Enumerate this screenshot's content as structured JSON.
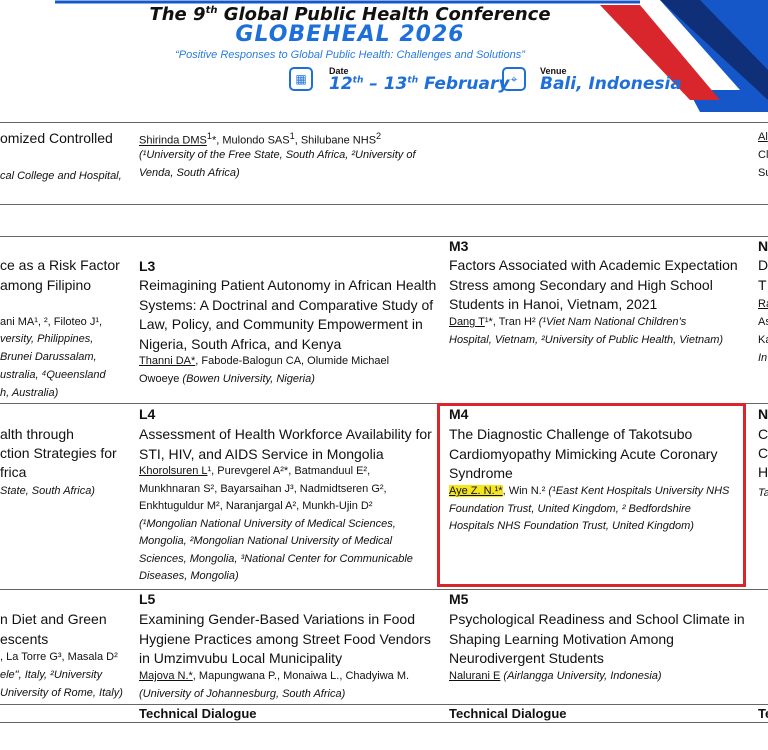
{
  "header": {
    "title_prefix": "The 9",
    "title_sup": "th",
    "title_suffix": " Global Public Health Conference",
    "name": "GLOBEHEAL 2026",
    "tagline": "“Positive Responses to Global Public Health: Challenges and Solutions”",
    "date_label": "Date",
    "date_a": "12",
    "date_a_sup": "th",
    "date_b": " – 13",
    "date_b_sup": "th",
    "date_c": " February",
    "venue_label": "Venue",
    "venue_value": "Bali, Indonesia",
    "accent": "#1e6fd9"
  },
  "row1": {
    "left_title_1": "omized Controlled",
    "left_auth_1": "cal College and Hospital,",
    "mid_auth_1": "Shirinda DMS",
    "mid_auth_1_sup": "1",
    "mid_auth_1_rest": "*, Mulondo SAS",
    "mid_auth_1_sup2": "1",
    "mid_auth_1_rest2": ", Shilubane NHS",
    "mid_auth_1_sup3": "2",
    "mid_auth_2": "(¹University of the Free State, South Africa, ²University of",
    "mid_auth_3": "Venda, South Africa)",
    "right_1": "Al",
    "right_2": "Cl",
    "right_3": "Su"
  },
  "row2": {
    "left_title_1": "ce as a Risk Factor",
    "left_title_2": "among Filipino",
    "left_auth_1": "ani MA¹, ², Filoteo J¹,",
    "left_auth_2": "versity, Philippines,",
    "left_auth_3": "Brunei Darussalam,",
    "left_auth_4": "ustralia, ⁴Queensland",
    "left_auth_5": "h, Australia)",
    "l_code": "L3",
    "l_title_1": "Reimagining Patient Autonomy in African Health",
    "l_title_2": "Systems: A Doctrinal and Comparative Study of",
    "l_title_3": "Law, Policy, and Community Empowerment in",
    "l_title_4": "Nigeria, South Africa, and Kenya",
    "l_auth_u": "Thanni DA*",
    "l_auth_1": ", Fabode-Balogun CA, Olumide Michael",
    "l_auth_2": "Owoeye",
    "l_auth_2i": " (Bowen University, Nigeria)",
    "m_code": "M3",
    "m_title_1": "Factors Associated with Academic Expectation",
    "m_title_2": "Stress among Secondary and High School",
    "m_title_3": "Students in Hanoi, Vietnam, 2021",
    "m_auth_u": "Dang T",
    "m_auth_1": "¹*, Tran H²",
    "m_auth_1i": " (¹Viet Nam National Children’s",
    "m_auth_2": "Hospital, Vietnam, ²University of Public Health, Vietnam)",
    "r_code": "N",
    "r_1": "D",
    "r_2": "T",
    "r_3": "Ra",
    "r_4": "As",
    "r_5": "Ka",
    "r_6": "In"
  },
  "row3": {
    "left_title_1": "alth through",
    "left_title_2": "ction Strategies for",
    "left_title_3": "frica",
    "left_auth_1": "State, South Africa)",
    "l_code": "L4",
    "l_title_1": "Assessment of Health Workforce Availability for",
    "l_title_2": "STI, HIV, and AIDS Service in Mongolia",
    "l_auth_u": "Khorolsuren L",
    "l_auth_1": "¹, Purevgerel A²*, Batmanduul E²,",
    "l_auth_2": "Munkhnaran S², Bayarsaihan J³, Nadmidtseren G²,",
    "l_auth_3": "Enkhtuguldur M², Naranjargal A², Munkh-Ujin D²",
    "l_auth_4": "(¹Mongolian National University of Medical Sciences,",
    "l_auth_5": "Mongolia, ²Mongolian National University of Medical",
    "l_auth_6": "Sciences, Mongolia, ³National Center for Communicable",
    "l_auth_7": "Diseases, Mongolia)",
    "m_code": "M4",
    "m_title_1": "The Diagnostic Challenge of Takotsubo",
    "m_title_2": "Cardiomyopathy Mimicking Acute Coronary",
    "m_title_3": "Syndrome",
    "m_auth_hl": "Aye Z. N.¹*",
    "m_auth_1": ", Win N.²",
    "m_auth_1i": " (¹East Kent Hospitals University NHS",
    "m_auth_2": "Foundation Trust, United Kingdom, ² Bedfordshire",
    "m_auth_3": "Hospitals NHS Foundation Trust, United Kingdom)",
    "r_code": "N",
    "r_1": "C",
    "r_2": "C",
    "r_3": "H",
    "r_4": "Ta"
  },
  "row4": {
    "left_title_1": "n Diet and Green",
    "left_title_2": "escents",
    "left_auth_1": ", La Torre G³, Masala D²",
    "left_auth_2": "ele\", Italy, ²University",
    "left_auth_3": "University of Rome, Italy)",
    "l_code": "L5",
    "l_title_1": "Examining Gender-Based Variations in Food",
    "l_title_2": "Hygiene Practices among Street Food Vendors",
    "l_title_3": "in Umzimvubu Local Municipality",
    "l_auth_u": "Majova N.*",
    "l_auth_1": ", Mapungwana P., Monaiwa L., Chadyiwa M.",
    "l_auth_2": "(University of Johannesburg, South Africa)",
    "m_code": "M5",
    "m_title_1": "Psychological Readiness and School Climate in",
    "m_title_2": "Shaping Learning Motivation Among",
    "m_title_3": "Neurodivergent Students",
    "m_auth_u": "Nalurani E",
    "m_auth_1": " (Airlangga University, Indonesia)"
  },
  "footer": {
    "l_label": "Technical Dialogue",
    "m_label": "Technical Dialogue",
    "r_label": "Te"
  }
}
